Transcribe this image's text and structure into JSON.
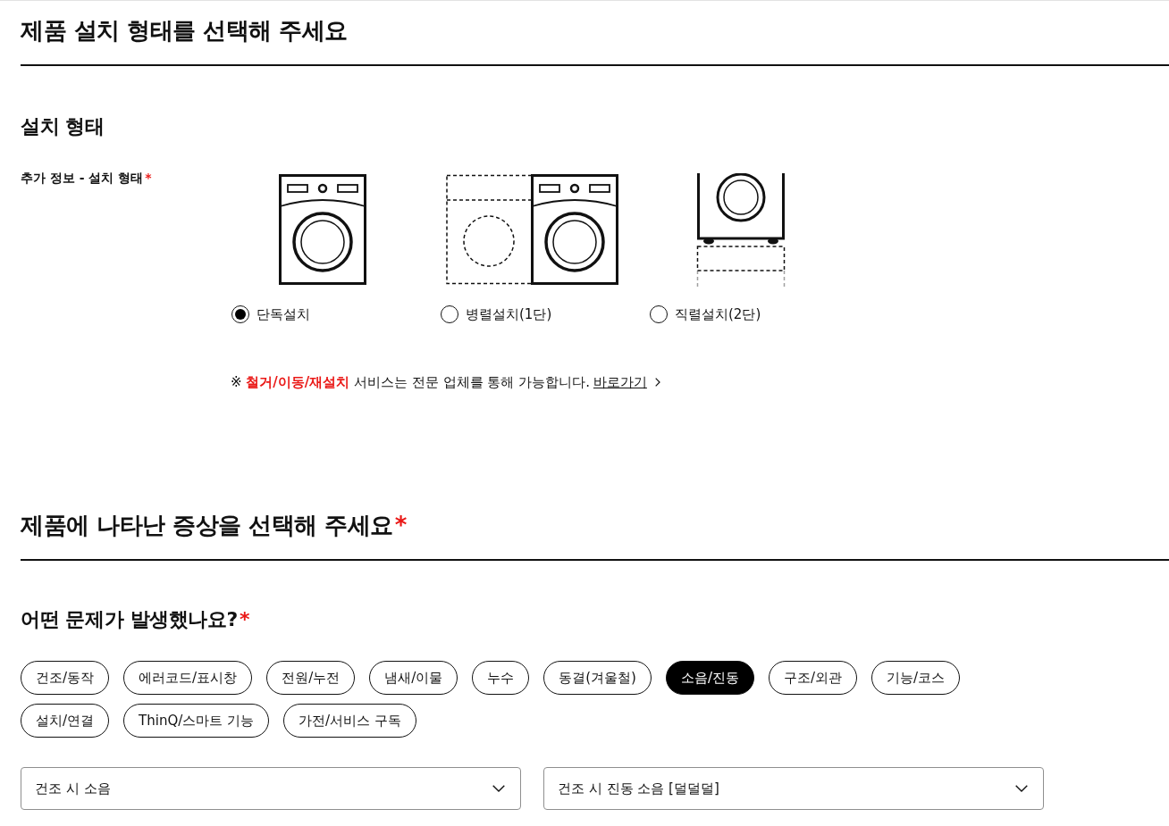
{
  "install_section": {
    "title": "제품 설치 형태를 선택해 주세요",
    "subtitle": "설치 형태",
    "field": {
      "label": "추가 정보 - 설치 형태",
      "required_mark": "*"
    },
    "options": [
      {
        "kind": "single",
        "label": "단독설치",
        "selected": true
      },
      {
        "kind": "side_by_side",
        "label": "병렬설치(1단)",
        "selected": false
      },
      {
        "kind": "stacked",
        "label": "직렬설치(2단)",
        "selected": false
      }
    ],
    "notice": {
      "text": "※ **철거/이동/재설치** 서비스는 전문 업체를 통해 가능합니다.",
      "link": "바로가기"
    }
  },
  "symptom_section": {
    "title": "제품에 나타난 증상을 선택해 주세요",
    "required_mark": "*",
    "question": {
      "label": "어떤 문제가 발생했나요?",
      "required_mark": "*"
    },
    "categories": [
      {
        "label": "건조/동작",
        "selected": false
      },
      {
        "label": "에러코드/표시창",
        "selected": false
      },
      {
        "label": "전원/누전",
        "selected": false
      },
      {
        "label": "냄새/이물",
        "selected": false
      },
      {
        "label": "누수",
        "selected": false
      },
      {
        "label": "동결(겨울철)",
        "selected": false
      },
      {
        "label": "소음/진동",
        "selected": true
      },
      {
        "label": "구조/외관",
        "selected": false
      },
      {
        "label": "기능/코스",
        "selected": false
      },
      {
        "label": "설치/연결",
        "selected": false
      },
      {
        "label": "ThinQ/스마트 기능",
        "selected": false
      },
      {
        "label": "가전/서비스 구독",
        "selected": false
      }
    ],
    "dropdowns": [
      {
        "value": "건조 시 소음"
      },
      {
        "value": "건조 시 진동 소음 [덜덜덜]"
      }
    ]
  }
}
